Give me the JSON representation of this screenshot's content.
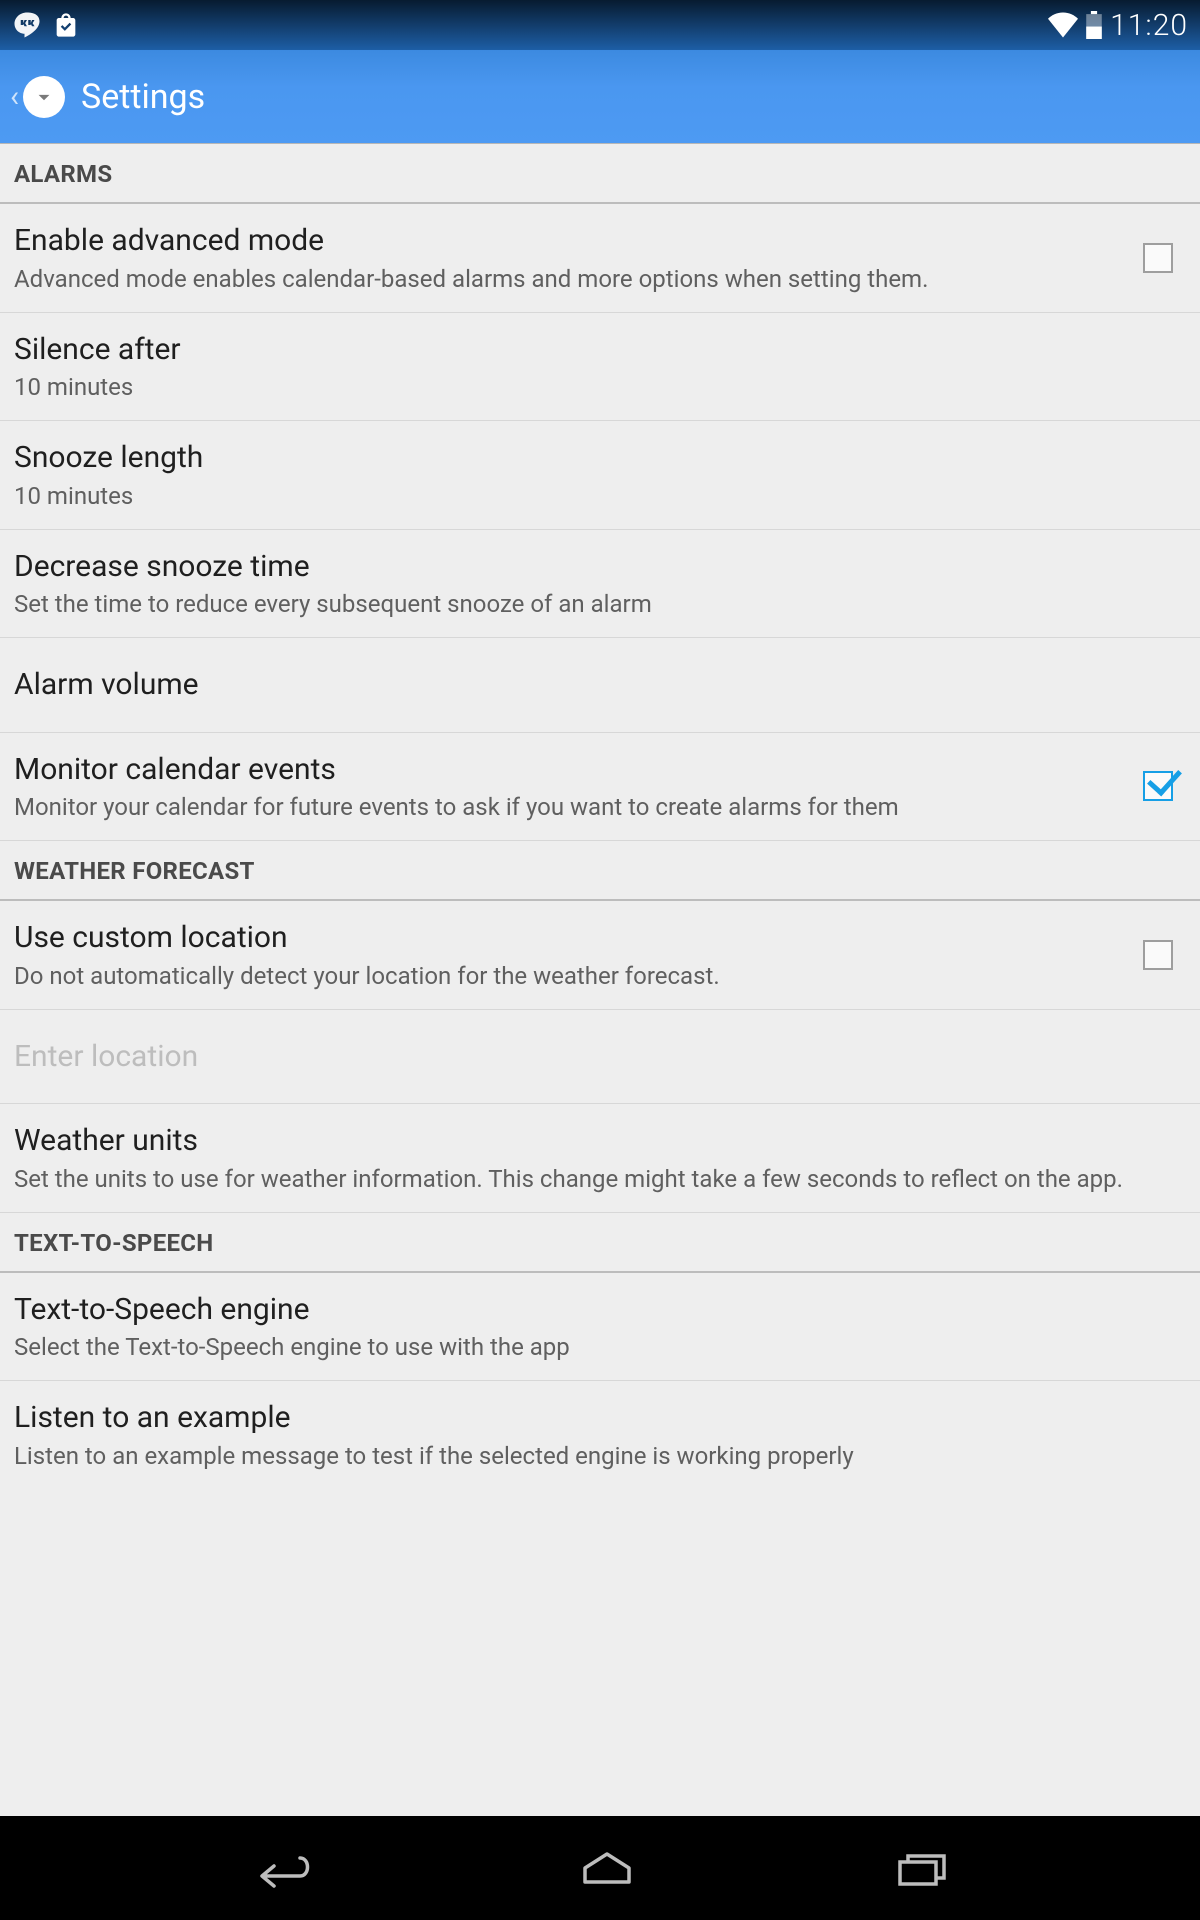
{
  "status": {
    "time": "11:20"
  },
  "appbar": {
    "title": "Settings"
  },
  "sections": {
    "alarms": {
      "header": "ALARMS",
      "enable_advanced": {
        "title": "Enable advanced mode",
        "sub": "Advanced mode enables calendar-based alarms and more options when setting them.",
        "checked": false
      },
      "silence_after": {
        "title": "Silence after",
        "sub": "10 minutes"
      },
      "snooze_length": {
        "title": "Snooze length",
        "sub": "10 minutes"
      },
      "decrease_snooze": {
        "title": "Decrease snooze time",
        "sub": "Set the time to reduce every subsequent snooze of an alarm"
      },
      "alarm_volume": {
        "title": "Alarm volume"
      },
      "monitor_calendar": {
        "title": "Monitor calendar events",
        "sub": "Monitor your calendar for future events to ask if you want to create alarms for them",
        "checked": true
      }
    },
    "weather": {
      "header": "WEATHER FORECAST",
      "custom_location": {
        "title": "Use custom location",
        "sub": "Do not automatically detect your location for the weather forecast.",
        "checked": false
      },
      "enter_location": {
        "title": "Enter location"
      },
      "units": {
        "title": "Weather units",
        "sub": "Set the units to use for weather information. This change might take a few seconds to reflect on the app."
      }
    },
    "tts": {
      "header": "TEXT-TO-SPEECH",
      "engine": {
        "title": "Text-to-Speech engine",
        "sub": "Select the Text-to-Speech engine to use with the app"
      },
      "example": {
        "title": "Listen to an example",
        "sub": "Listen to an example message to test if the selected engine is working properly"
      }
    }
  }
}
